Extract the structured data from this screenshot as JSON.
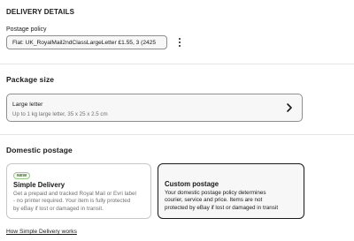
{
  "header": {
    "title": "DELIVERY DETAILS"
  },
  "postage_policy": {
    "label": "Postage policy",
    "value": "Flat: UK_RoyalMail2ndClassLargeLetter £1.55, 3 (2425",
    "more_icon": "more-vertical-icon"
  },
  "package_size": {
    "title": "Package size",
    "selected_title": "Large letter",
    "selected_desc": "Up to 1 kg large letter, 35 x 25 x 2.5 cm",
    "chevron_icon": "chevron-right-icon"
  },
  "domestic_postage": {
    "title": "Domestic postage",
    "options": [
      {
        "badge": "NEW",
        "title": "Simple Delivery",
        "desc_lines": [
          "Get a prepaid and tracked Royal Mail or Evri label",
          "- no printer required. Your item is fully protected",
          "by eBay if lost or damaged in transit."
        ],
        "selected": false
      },
      {
        "title": "Custom postage",
        "desc_lines": [
          "Your domestic postage policy determines",
          "courier, service and price. Items are not",
          "protected by eBay if lost or damaged in transit"
        ],
        "selected": true
      }
    ],
    "link": "How Simple Delivery works"
  },
  "colors": {
    "text": "#191919",
    "border": "#8f8f8f",
    "field_bg": "#f7f7f7",
    "badge_green": "#3a6b1e"
  }
}
